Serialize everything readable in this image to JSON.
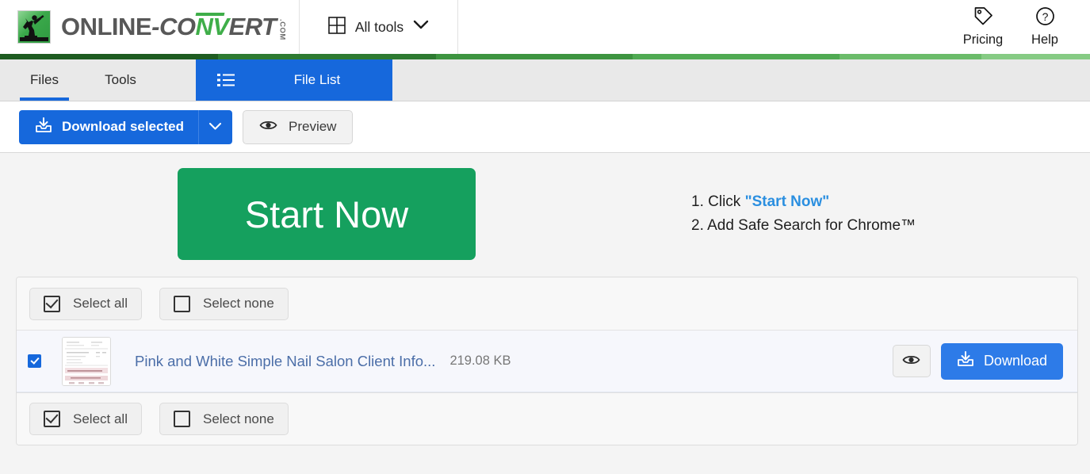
{
  "header": {
    "logo": {
      "part1": "ONLINE",
      "part2": "-CO",
      "part3": "NV",
      "part4": "ERT",
      "suffix": ".COM",
      "icon": "running-man-logo-icon"
    },
    "all_tools": {
      "label": "All tools",
      "grid_icon": "grid-icon",
      "chevron_icon": "chevron-down-icon"
    },
    "actions": [
      {
        "label": "Pricing",
        "icon": "price-tag-icon"
      },
      {
        "label": "Help",
        "icon": "question-circle-icon"
      }
    ]
  },
  "greenbar": {
    "colors": [
      "#1e5c21",
      "#2d7a31",
      "#3d9440",
      "#4faa52",
      "#6bbc6a",
      "#86cb84"
    ]
  },
  "tabs": {
    "files": "Files",
    "tools": "Tools",
    "file_list": "File List",
    "file_list_icon": "list-icon",
    "active": "File List",
    "accent": "#1668dc"
  },
  "toolbar": {
    "download_selected": "Download selected",
    "download_icon": "download-tray-icon",
    "caret_icon": "chevron-down-icon",
    "preview": "Preview",
    "preview_icon": "eye-icon"
  },
  "promo": {
    "start_now": "Start Now",
    "start_now_color": "#15a05e",
    "steps": [
      {
        "num": "1.",
        "text": "Click ",
        "highlight": "\"Start Now\"",
        "after": ""
      },
      {
        "num": "2.",
        "text": "Add Safe Search for Chrome™",
        "highlight": "",
        "after": ""
      }
    ]
  },
  "file_card": {
    "select_all": "Select all",
    "select_none": "Select none",
    "select_all_icon": "checkbox-checked-icon",
    "select_none_icon": "checkbox-empty-icon",
    "row": {
      "checked": true,
      "checkbox_name": "file-checkbox",
      "thumbnail": "document-thumbnail",
      "filename": "Pink and White Simple Nail Salon Client Info...",
      "filesize": "219.08 KB",
      "preview_icon": "eye-icon",
      "download_label": "Download",
      "download_icon": "download-tray-icon"
    }
  }
}
